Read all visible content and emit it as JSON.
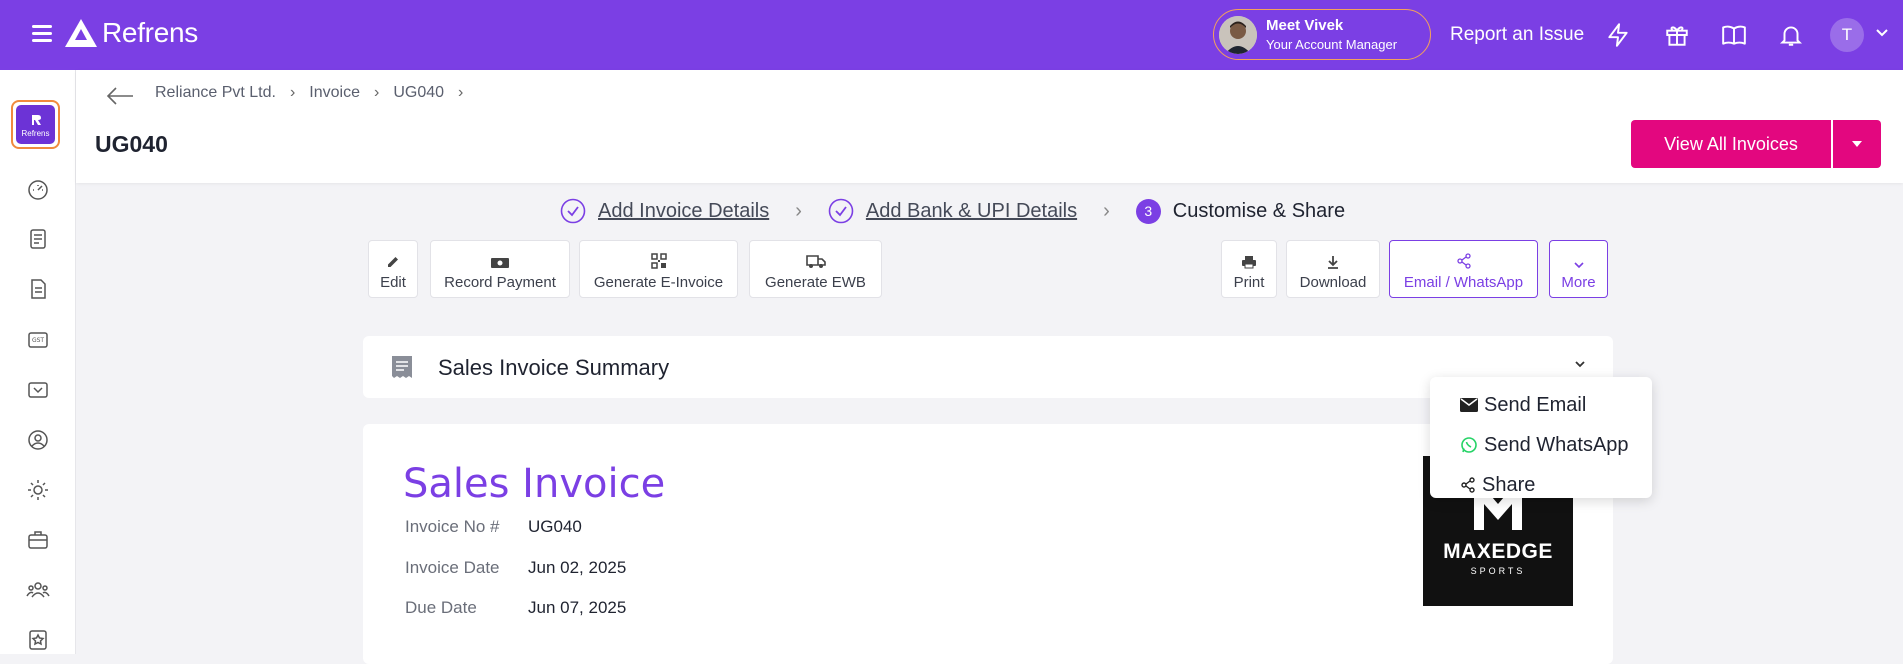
{
  "app": {
    "name": "Refrens"
  },
  "topbar": {
    "manager_name": "Meet Vivek",
    "manager_role": "Your Account Manager",
    "report_label": "Report an Issue",
    "avatar_letter": "T"
  },
  "sidebar": {
    "logo_text": "Refrens"
  },
  "breadcrumb": {
    "items": [
      "Reliance Pvt Ltd.",
      "Invoice",
      "UG040"
    ]
  },
  "page": {
    "title": "UG040",
    "view_all_label": "View All Invoices"
  },
  "steps": [
    {
      "label": "Add Invoice Details"
    },
    {
      "label": "Add Bank & UPI Details"
    },
    {
      "num": "3",
      "label": "Customise & Share"
    }
  ],
  "actions": {
    "edit": "Edit",
    "record_payment": "Record Payment",
    "e_invoice": "Generate E-Invoice",
    "ewb": "Generate EWB",
    "print": "Print",
    "download": "Download",
    "email_whatsapp": "Email / WhatsApp",
    "more": "More"
  },
  "dropdown": {
    "send_email": "Send Email",
    "send_whatsapp": "Send WhatsApp",
    "share": "Share"
  },
  "summary": {
    "title": "Sales Invoice Summary"
  },
  "invoice": {
    "title": "Sales Invoice",
    "invoice_no_label": "Invoice No #",
    "invoice_no": "UG040",
    "invoice_date_label": "Invoice Date",
    "invoice_date": "Jun 02, 2025",
    "due_date_label": "Due Date",
    "due_date": "Jun 07, 2025",
    "brand_name": "MAXEDGE",
    "brand_sub": "SPORTS"
  },
  "colors": {
    "primary": "#7b3fe4",
    "accent": "#e3077f",
    "whatsapp": "#25d366"
  }
}
